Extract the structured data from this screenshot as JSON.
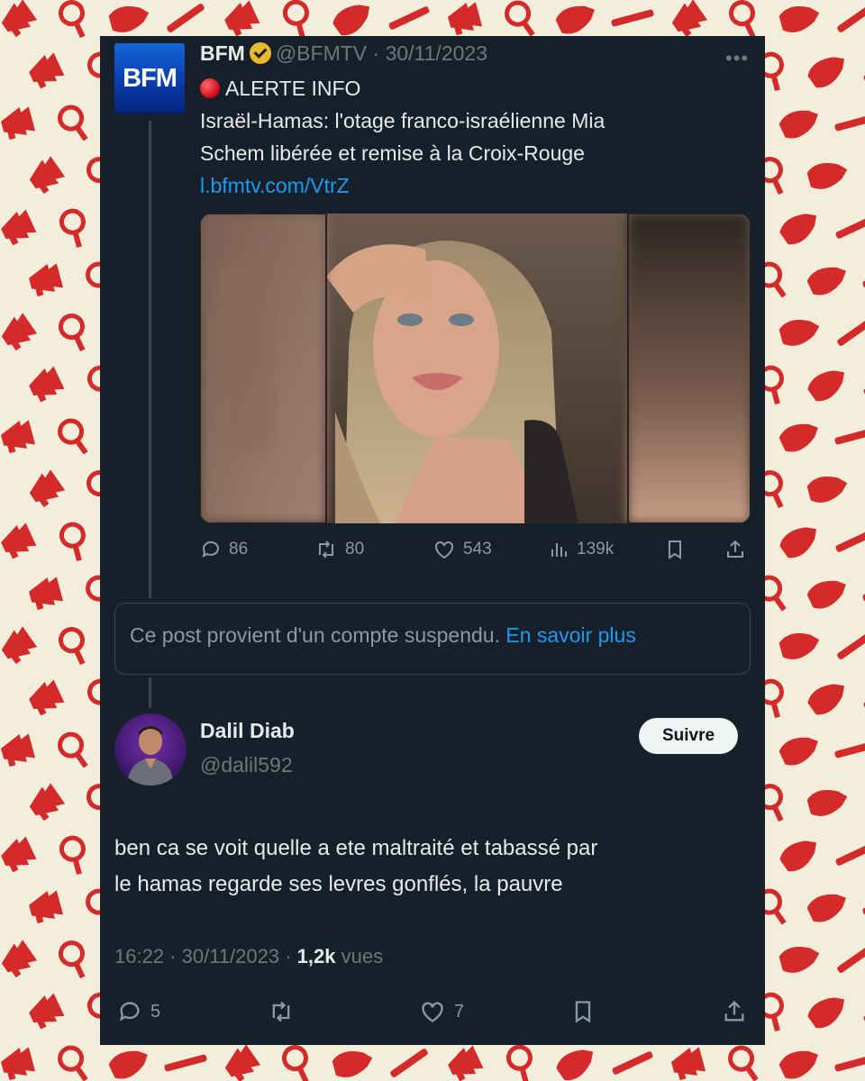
{
  "colors": {
    "background_pattern": "#f3eddc",
    "pattern_red": "#d42a2a",
    "card_bg": "#15202b",
    "link_blue": "#1d9bf0",
    "verified_gold": "#e8b92d"
  },
  "original_tweet": {
    "logo_text": "BFM",
    "display_name": "BFM",
    "handle": "@BFMTV",
    "date": "30/11/2023",
    "separator": "·",
    "alert_label": "ALERTE INFO",
    "text_line1": "Israël-Hamas: l'otage franco-israélienne Mia",
    "text_line2": "Schem libérée et remise à la Croix-Rouge",
    "link": "l.bfmtv.com/VtrZ",
    "stats": {
      "replies": "86",
      "reposts": "80",
      "likes": "543",
      "views": "139k"
    }
  },
  "suspended_notice": {
    "text": "Ce post provient d'un compte suspendu.",
    "link": "En savoir plus"
  },
  "reply_tweet": {
    "display_name": "Dalil Diab",
    "handle": "@dalil592",
    "follow_label": "Suivre",
    "text_line1": "ben ca se voit quelle a ete maltraité et tabassé par",
    "text_line2": "le hamas regarde ses levres gonflés, la pauvre",
    "time": "16:22",
    "date": "30/11/2023",
    "views_count": "1,2k",
    "views_label": "vues",
    "stats": {
      "replies": "5",
      "likes": "7"
    }
  }
}
